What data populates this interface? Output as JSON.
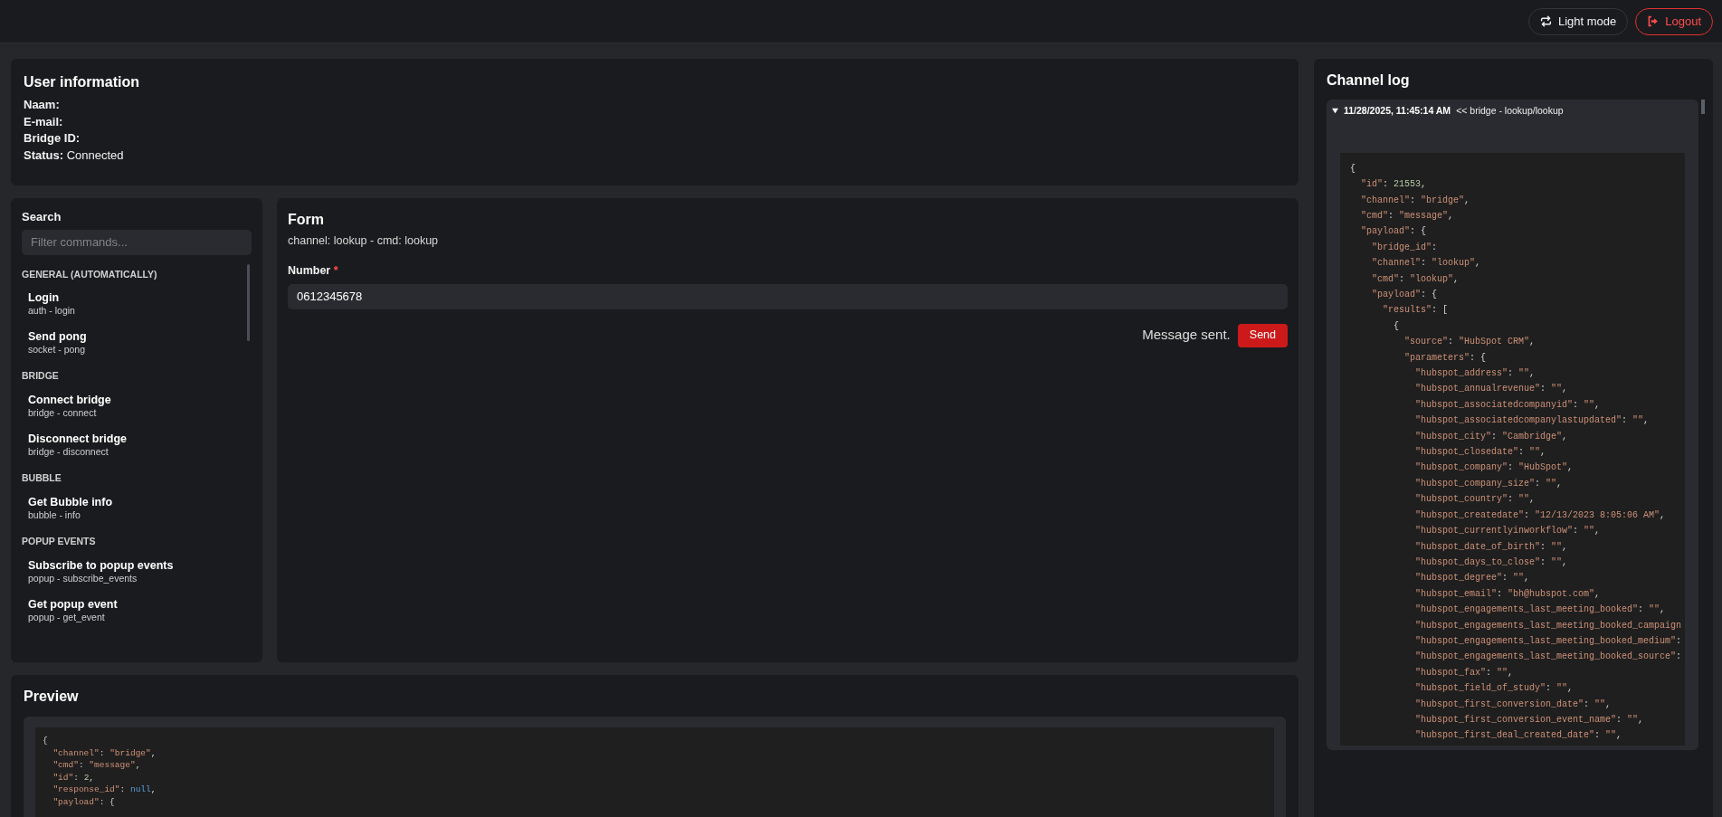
{
  "header": {
    "buttons": [
      {
        "kind": "theme",
        "label": "Light mode"
      },
      {
        "kind": "logout",
        "label": "Logout"
      }
    ]
  },
  "user_information": {
    "title": "User information",
    "fields": [
      {
        "label": "Naam:"
      },
      {
        "label": "E-mail:"
      },
      {
        "label": "Bridge ID:"
      },
      {
        "label": "Status:",
        "value": "Connected"
      }
    ]
  },
  "commands": {
    "search_label": "Search",
    "search": {
      "placeholder": "Filter commands..."
    },
    "groups": [
      {
        "title": "GENERAL (AUTOMATICALLY)",
        "items": [
          {
            "name": "Login",
            "command": "auth - login"
          },
          {
            "name": "Send pong",
            "command": "socket - pong"
          }
        ]
      },
      {
        "title": "BRIDGE",
        "items": [
          {
            "name": "Connect bridge",
            "command": "bridge - connect"
          },
          {
            "name": "Disconnect bridge",
            "command": "bridge - disconnect"
          }
        ]
      },
      {
        "title": "BUBBLE",
        "items": [
          {
            "name": "Get Bubble info",
            "command": "bubble - info"
          }
        ]
      },
      {
        "title": "POPUP EVENTS",
        "items": [
          {
            "name": "Subscribe to popup events",
            "command": "popup - subscribe_events"
          },
          {
            "name": "Get popup event",
            "command": "popup - get_event"
          }
        ]
      }
    ]
  },
  "form": {
    "title": "Form",
    "subtitle": "channel: lookup - cmd: lookup",
    "fields": [
      {
        "label": "Number",
        "required_mark": "*",
        "value": "0612345678"
      }
    ],
    "status": "Message sent.",
    "submit": "Send"
  },
  "preview": {
    "title": "Preview",
    "code": [
      "{",
      "  \"channel\": \"bridge\",",
      "  \"cmd\": \"message\",",
      "  \"id\": 2,",
      "  \"response_id\": null,",
      "  \"payload\": {"
    ]
  },
  "channel_log": {
    "title": "Channel log",
    "entries": [
      {
        "expanded": true,
        "time": "11/28/2025, 11:45:14 AM",
        "summary": "<< bridge - lookup/lookup",
        "code": [
          "{",
          "  \"id\": 21553,",
          "  \"channel\": \"bridge\",",
          "  \"cmd\": \"message\",",
          "  \"payload\": {",
          "    \"bridge_id\":",
          "    \"channel\": \"lookup\",",
          "    \"cmd\": \"lookup\",",
          "    \"payload\": {",
          "      \"results\": [",
          "        {",
          "          \"source\": \"HubSpot CRM\",",
          "          \"parameters\": {",
          "            \"hubspot_address\": \"\",",
          "            \"hubspot_annualrevenue\": \"\",",
          "            \"hubspot_associatedcompanyid\": \"\",",
          "            \"hubspot_associatedcompanylastupdated\": \"\",",
          "            \"hubspot_city\": \"Cambridge\",",
          "            \"hubspot_closedate\": \"\",",
          "            \"hubspot_company\": \"HubSpot\",",
          "            \"hubspot_company_size\": \"\",",
          "            \"hubspot_country\": \"\",",
          "            \"hubspot_createdate\": \"12/13/2023 8:05:06 AM\",",
          "            \"hubspot_currentlyinworkflow\": \"\",",
          "            \"hubspot_date_of_birth\": \"\",",
          "            \"hubspot_days_to_close\": \"\",",
          "            \"hubspot_degree\": \"\",",
          "            \"hubspot_email\": \"bh@hubspot.com\",",
          "            \"hubspot_engagements_last_meeting_booked\": \"\",",
          "            \"hubspot_engagements_last_meeting_booked_campaign",
          "            \"hubspot_engagements_last_meeting_booked_medium\":",
          "            \"hubspot_engagements_last_meeting_booked_source\":",
          "            \"hubspot_fax\": \"\",",
          "            \"hubspot_field_of_study\": \"\",",
          "            \"hubspot_first_conversion_date\": \"\",",
          "            \"hubspot_first_conversion_event_name\": \"\",",
          "            \"hubspot_first_deal_created_date\": \"\","
        ]
      }
    ]
  }
}
